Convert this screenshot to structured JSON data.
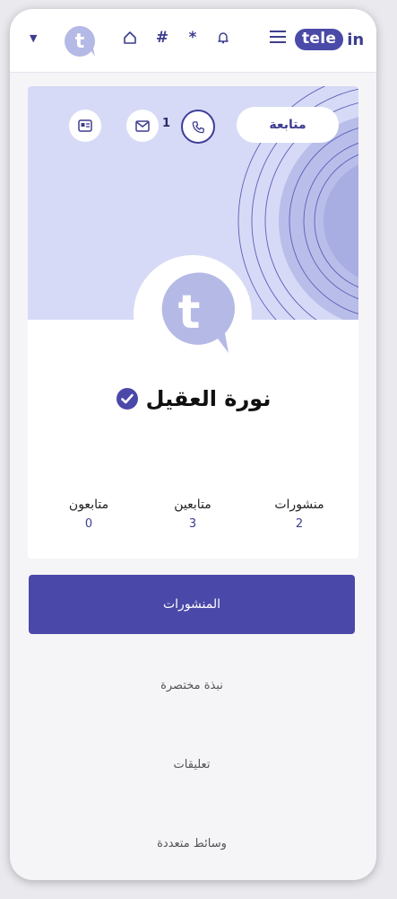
{
  "nav": {
    "logo_pill": "tele",
    "logo_rest": "in",
    "avatar_letter": "t",
    "hash_glyph": "#",
    "star_glyph": "*"
  },
  "profile": {
    "follow_label": "متابعة",
    "call_count": "1",
    "avatar_letter": "t",
    "name": "نورة العقيل"
  },
  "stats": [
    {
      "label": "منشورات",
      "value": "2"
    },
    {
      "label": "متابعين",
      "value": "3"
    },
    {
      "label": "متابعون",
      "value": "0"
    }
  ],
  "tabs": {
    "active": "المنشورات",
    "items": [
      "نبذة مختصرة",
      "تعليقات",
      "وسائط متعددة"
    ]
  },
  "colors": {
    "accent": "#4a48a8",
    "cover": "#d7daf6",
    "avatar": "#b5b9e6"
  }
}
